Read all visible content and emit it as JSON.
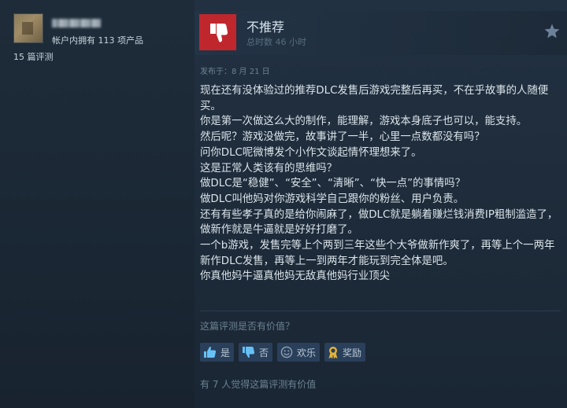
{
  "user": {
    "products_owned": "帐户内拥有 113 项产品",
    "review_count": "15 篇评测"
  },
  "review": {
    "verdict": "不推荐",
    "playtime": "总时数 46 小时",
    "posted": "发布于：8 月 21 日",
    "body_lines": [
      "现在还有没体验过的推荐DLC发售后游戏完整后再买，不在乎故事的人随便买。",
      "你是第一次做这么大的制作，能理解，游戏本身底子也可以，能支持。",
      "然后呢？游戏没做完，故事讲了一半，心里一点数都没有吗？",
      "问你DLC呢微博发个小作文谈起情怀理想来了。",
      "这是正常人类该有的思维吗？",
      "做DLC是“稳健”、“安全”、“清晰”、“快一点”的事情吗？",
      "做DLC叫他妈对你游戏科学自己跟你的粉丝、用户负责。",
      "还有有些孝子真的是给你闹麻了，做DLC就是躺着赚烂钱消费IP粗制滥造了，做新作就是牛逼就是好好打磨了。",
      "一个b游戏，发售完等上个两到三年这些个大爷做新作爽了，再等上个一两年新作DLC发售，再等上一到两年才能玩到完全体是吧。",
      "你真他妈牛逼真他妈无敌真他妈行业顶尖"
    ],
    "helpful_question": "这篇评测是否有价值？",
    "buttons": {
      "yes": "是",
      "no": "否",
      "funny": "欢乐",
      "award": "奖励"
    },
    "helpful_count": "有 7 人觉得这篇评测有价值"
  },
  "icons": {
    "verdict": "thumbs-down-icon",
    "award_star": "star-icon",
    "yes": "thumbs-up-icon",
    "no": "thumbs-down-icon",
    "funny": "smiley-icon",
    "award": "award-ribbon-icon"
  },
  "colors": {
    "background": "#1b2838",
    "not_recommended": "#c0272d",
    "button_bg": "#2a3f5a",
    "award_icon": "#e5b43a"
  }
}
